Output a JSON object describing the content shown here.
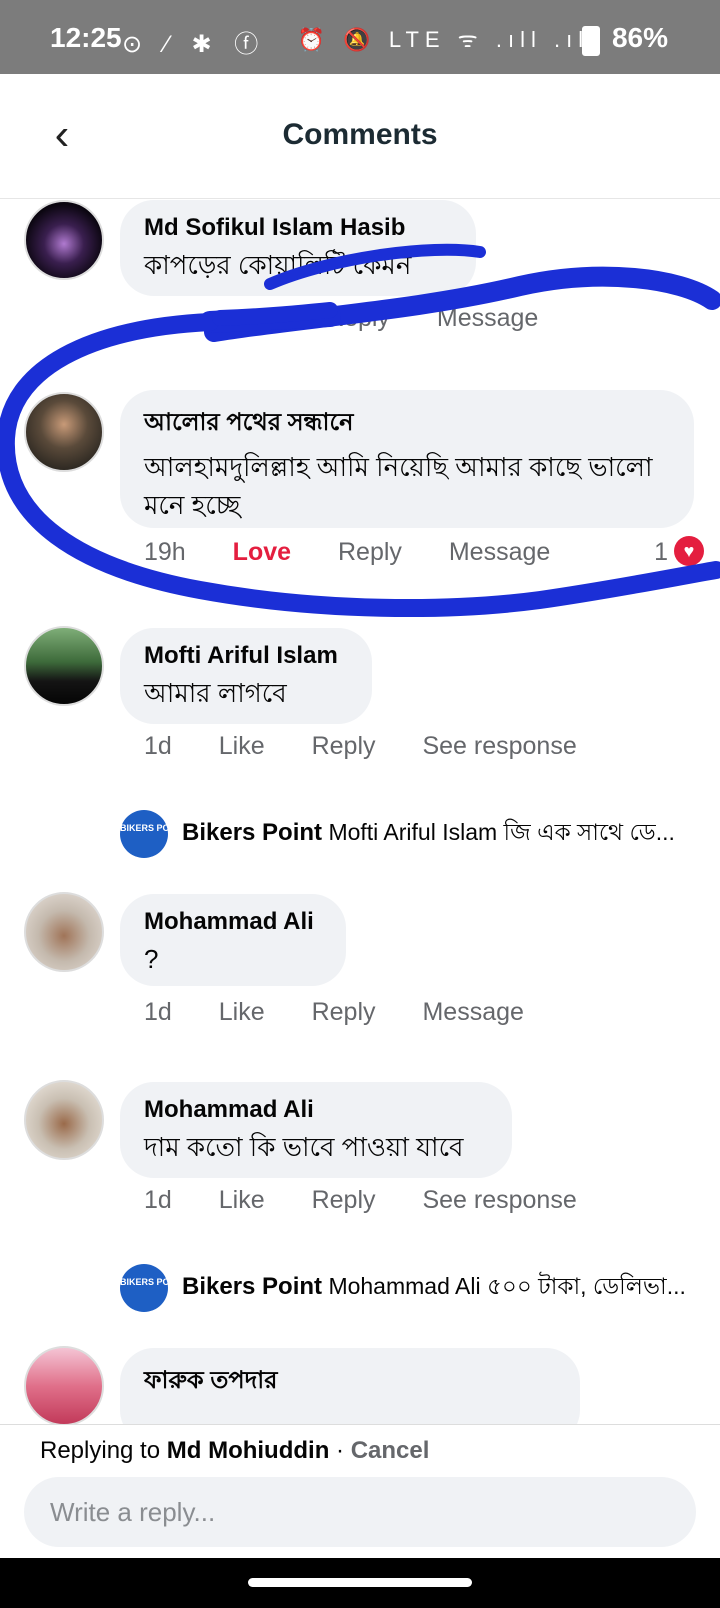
{
  "status": {
    "time": "12:25",
    "battery": "86%",
    "left_icons": "⊙ ∕ ✱ ⓕ",
    "right_icons": "⏰ 🔕 LTE ᯤ .ıll .ıll"
  },
  "header": {
    "title": "Comments",
    "back_icon": "chevron-left-icon"
  },
  "comments": [
    {
      "name": "Md Sofikul Islam Hasib",
      "text": "কাপড়ের কোয়ালিটি কেমন",
      "time": "",
      "a1": "Reply",
      "a2": "Message"
    },
    {
      "name": "আলোর পথের সন্ধানে",
      "text": "আলহামদুলিল্লাহ আমি নিয়েছি আমার কাছে ভালো মনে হচ্ছে",
      "time": "19h",
      "a0": "Love",
      "a1": "Reply",
      "a2": "Message",
      "reactions": "1"
    },
    {
      "name": "Mofti Ariful Islam",
      "text": "আমার লাগবে",
      "time": "1d",
      "a0": "Like",
      "a1": "Reply",
      "a2": "See response"
    },
    {
      "name": "Mohammad Ali",
      "text": "?",
      "time": "1d",
      "a0": "Like",
      "a1": "Reply",
      "a2": "Message"
    },
    {
      "name": "Mohammad Ali",
      "text": "দাম কতো কি ভাবে পাওয়া যাবে",
      "time": "1d",
      "a0": "Like",
      "a1": "Reply",
      "a2": "See response"
    },
    {
      "name": "ফারুক তপদার",
      "text": ""
    }
  ],
  "replies": [
    {
      "author": "Bikers Point",
      "snippet": "Mofti Ariful Islam জি এক সাথে ডে..."
    },
    {
      "author": "Bikers Point",
      "snippet": "Mohammad Ali ৫০০ টাকা, ডেলিভা..."
    }
  ],
  "page_avatar_text": "BIKERS POINT",
  "composer": {
    "replying_prefix": "Replying to",
    "replying_name": "Md Mohiuddin",
    "separator": "·",
    "cancel": "Cancel",
    "placeholder": "Write a reply..."
  },
  "colors": {
    "annotation": "#1b2fd6",
    "love": "#e41e3f",
    "bubble": "#f0f2f5"
  }
}
